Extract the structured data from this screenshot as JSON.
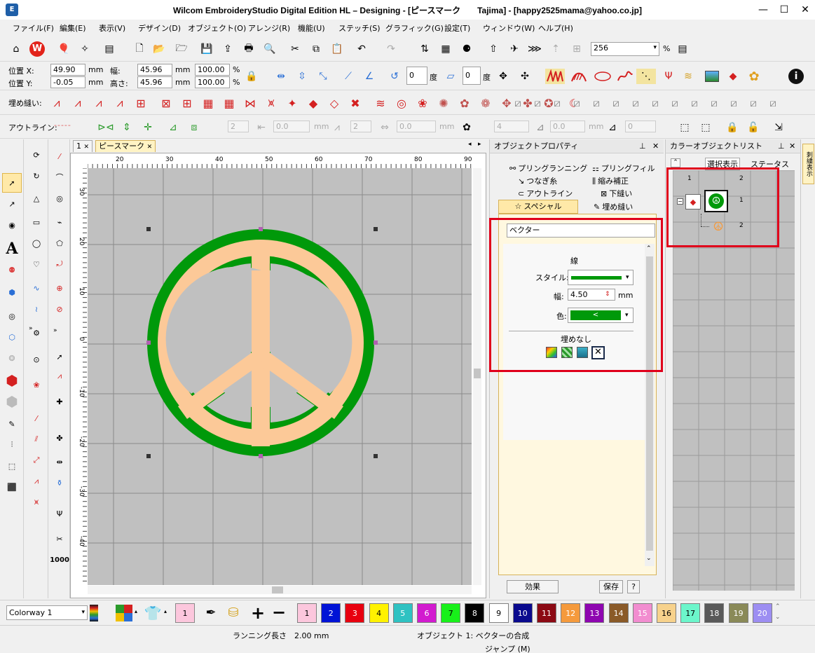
{
  "window": {
    "app_icon": "wilcom-icon",
    "title": "Wilcom EmbroideryStudio Digital Edition HL – Designing - [ピースマーク　　Tajima] - [happy2525mama@yahoo.co.jp]",
    "minimize": "—",
    "maximize": "☐",
    "close": "✕"
  },
  "menu": [
    "ファイル(F)",
    "編集(E)",
    "表示(V)",
    "デザイン(D)",
    "オブジェクト(O)",
    "アレンジ(R)",
    "機能(U)",
    "ステッチ(S)",
    "グラフィック(G)",
    "設定(T)",
    "ウィンドウ(W)",
    "ヘルプ(H)"
  ],
  "zoom": {
    "value": "256",
    "unit": "%"
  },
  "position": {
    "x_label": "位置 X:",
    "x_value": "49.90",
    "y_label": "位置 Y:",
    "y_value": "-0.05",
    "unit": "mm",
    "width_label": "幅:",
    "width_value": "45.96",
    "height_label": "高さ:",
    "height_value": "45.96",
    "scale_x": "100.00",
    "scale_y": "100.00",
    "pct": "%",
    "rotate_value": "0",
    "deg": "度",
    "slant_value": "0"
  },
  "fill_toolbar": {
    "label": "埋め縫い:"
  },
  "outline_toolbar": {
    "label": "アウトライン:",
    "values": [
      "2",
      "0.0",
      "2",
      "0.0",
      "4",
      "0.0",
      "0"
    ],
    "unit": "mm"
  },
  "doc_tabs": [
    {
      "label": "1",
      "close": "✕"
    },
    {
      "label": "ピースマーク",
      "close": "✕"
    }
  ],
  "ruler": {
    "top": [
      "20",
      "30",
      "40",
      "50",
      "60",
      "70",
      "80",
      "90"
    ],
    "left": [
      "30",
      "20",
      "10",
      "0",
      "-10",
      "-20",
      "-30",
      "-40",
      "-50"
    ]
  },
  "colors": {
    "green": "#00990a",
    "peach": "#fcc998",
    "canvas": "#c0c0c0",
    "red": "#e0001b",
    "accent": "#1f5fa8"
  },
  "object_properties": {
    "title": "オブジェクトプロパティ",
    "pin": "📌",
    "close": "✕",
    "tabs": [
      {
        "label": "プリングランニング",
        "icon": "pull-running-icon"
      },
      {
        "label": "プリングフィル",
        "icon": "pull-fill-icon"
      },
      {
        "label": "つなぎ糸",
        "icon": "connector-icon"
      },
      {
        "label": "縮み補正",
        "icon": "compensation-icon"
      },
      {
        "label": "アウトライン",
        "icon": "outline-icon"
      },
      {
        "label": "下縫い",
        "icon": "underlay-icon"
      },
      {
        "label": "スペシャル",
        "icon": "star-icon"
      },
      {
        "label": "埋め縫い",
        "icon": "fill-icon"
      }
    ],
    "object_name": "ベクター",
    "line_header": "線",
    "style_label": "スタイル:",
    "width_label": "幅:",
    "width_value": "4.50",
    "width_unit": "mm",
    "color_label": "色:",
    "fill_header": "埋めなし",
    "effects_button": "効果",
    "save_button": "保存",
    "help_button": "?"
  },
  "color_object_list": {
    "title": "カラーオブジェクトリスト",
    "pin": "📌",
    "close": "✕",
    "collapse": "⌃",
    "show_selection": "選択表示",
    "status": "ステータス",
    "tree_toggle": "−",
    "header": [
      "1",
      "2"
    ],
    "rows": [
      {
        "num": "1"
      },
      {
        "num": "2"
      }
    ],
    "side_tab": "刺繍表示"
  },
  "palette": {
    "colorway": "Colorway 1",
    "current": "1",
    "swatches": [
      {
        "n": "1",
        "color": "#fcc7dd",
        "text": "#000"
      },
      {
        "n": "2",
        "color": "#0013d6",
        "text": "#fff"
      },
      {
        "n": "3",
        "color": "#e8000f",
        "text": "#fff"
      },
      {
        "n": "4",
        "color": "#fff200",
        "text": "#000"
      },
      {
        "n": "5",
        "color": "#2fc2c2",
        "text": "#fff"
      },
      {
        "n": "6",
        "color": "#d21bcf",
        "text": "#fff"
      },
      {
        "n": "7",
        "color": "#18f01a",
        "text": "#000"
      },
      {
        "n": "8",
        "color": "#000000",
        "text": "#fff"
      },
      {
        "n": "9",
        "color": "#ffffff",
        "text": "#000"
      },
      {
        "n": "10",
        "color": "#0a0a8e",
        "text": "#fff"
      },
      {
        "n": "11",
        "color": "#8c0a14",
        "text": "#fff"
      },
      {
        "n": "12",
        "color": "#f59a3c",
        "text": "#fff"
      },
      {
        "n": "13",
        "color": "#8e06b0",
        "text": "#fff"
      },
      {
        "n": "14",
        "color": "#8a5a28",
        "text": "#fff"
      },
      {
        "n": "15",
        "color": "#f28dd0",
        "text": "#fff"
      },
      {
        "n": "16",
        "color": "#f7d28c",
        "text": "#000"
      },
      {
        "n": "17",
        "color": "#6cf6cb",
        "text": "#000"
      },
      {
        "n": "18",
        "color": "#595959",
        "text": "#fff"
      },
      {
        "n": "19",
        "color": "#8a8a58",
        "text": "#fff"
      },
      {
        "n": "20",
        "color": "#9d8ef2",
        "text": "#fff"
      }
    ]
  },
  "status": {
    "running_length": "ランニング長さ　2.00 mm",
    "object_info": "オブジェクト 1: ベクターの合成",
    "jump": "ジャンプ (M)"
  }
}
